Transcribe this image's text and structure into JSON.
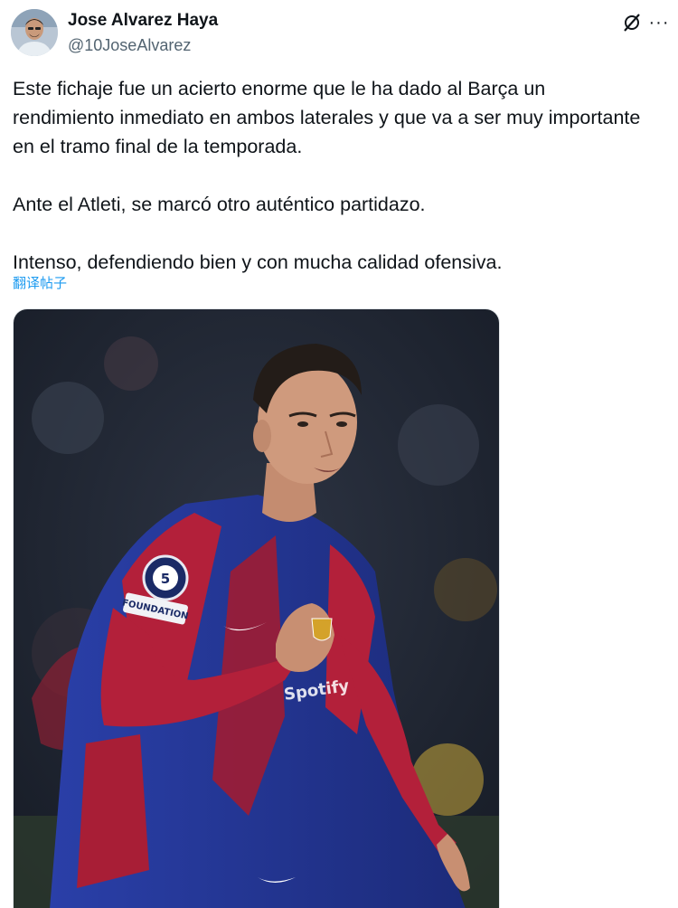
{
  "author": {
    "display_name": "Jose Alvarez Haya",
    "handle": "@10JoseAlvarez"
  },
  "tweet": {
    "text": "Este fichaje fue un acierto enorme que le ha dado al Barça un\nrendimiento inmediato en ambos laterales y que va a ser muy importante\nen el tramo final de la temporada.\n\nAnte el Atleti, se marcó otro auténtico partidazo.\n\nIntenso, defendiendo bien y con mucha calidad ofensiva.",
    "translate_label": "翻译帖子"
  },
  "media": {
    "jersey_sponsor": "Spotify",
    "badge_text": "FOUNDATION"
  },
  "icons": {
    "grok": "grok-icon",
    "more": "more-icon"
  },
  "colors": {
    "link": "#1d9bf0",
    "secondary_text": "#536471",
    "jersey_blue": "#2a3fa8",
    "jersey_red": "#b3203a"
  }
}
